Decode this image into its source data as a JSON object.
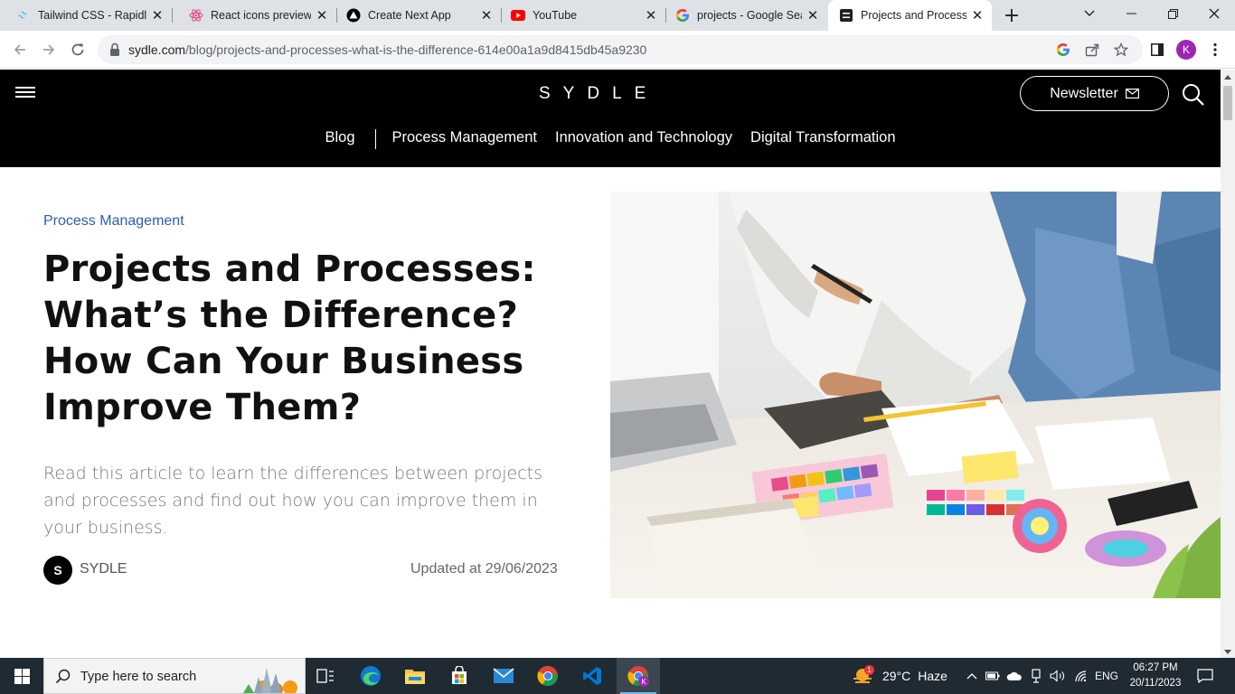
{
  "browser": {
    "tabs": [
      {
        "title": "Tailwind CSS - Rapidly build modern websites",
        "icon": "tailwind-icon",
        "active": false
      },
      {
        "title": "React icons preview for the most popular icon libraries",
        "icon": "react-icon",
        "active": false
      },
      {
        "title": "Create Next App",
        "icon": "nextjs-icon",
        "active": false
      },
      {
        "title": "YouTube",
        "icon": "youtube-icon",
        "active": false
      },
      {
        "title": "projects - Google Search",
        "icon": "google-icon",
        "active": false
      },
      {
        "title": "Projects and Processes: What's the Difference?",
        "icon": "sydle-icon",
        "active": true
      }
    ],
    "url_host": "sydle.com",
    "url_path": "/blog/projects-and-processes-what-is-the-difference-614e00a1a9d8415db45a9230",
    "profile_initial": "K",
    "accent_color": "#9c27b0"
  },
  "site": {
    "logo": "SYDLE",
    "newsletter_label": "Newsletter",
    "nav": [
      "Blog",
      "Process Management",
      "Innovation and Technology",
      "Digital Transformation"
    ]
  },
  "article": {
    "category": "Process Management",
    "title": "Projects and Processes: What’s the Difference? How Can Your Business Improve Them?",
    "description": "Read this article to learn the differences between projects and processes and find out how you can improve them in your business.",
    "author_initial": "S",
    "author": "SYDLE",
    "updated": "Updated at 29/06/2023",
    "image_alt": "people-working-on-color-palettes"
  },
  "taskbar": {
    "search_placeholder": "Type here to search",
    "weather_temp": "29°C",
    "weather_desc": "Haze",
    "weather_badge": "1",
    "language": "ENG",
    "time": "06:27 PM",
    "date": "20/11/2023",
    "apps": [
      "task-view-icon",
      "edge-icon",
      "file-explorer-icon",
      "microsoft-store-icon",
      "mail-icon",
      "chrome-icon",
      "vscode-icon",
      "chrome-profile-icon"
    ]
  }
}
